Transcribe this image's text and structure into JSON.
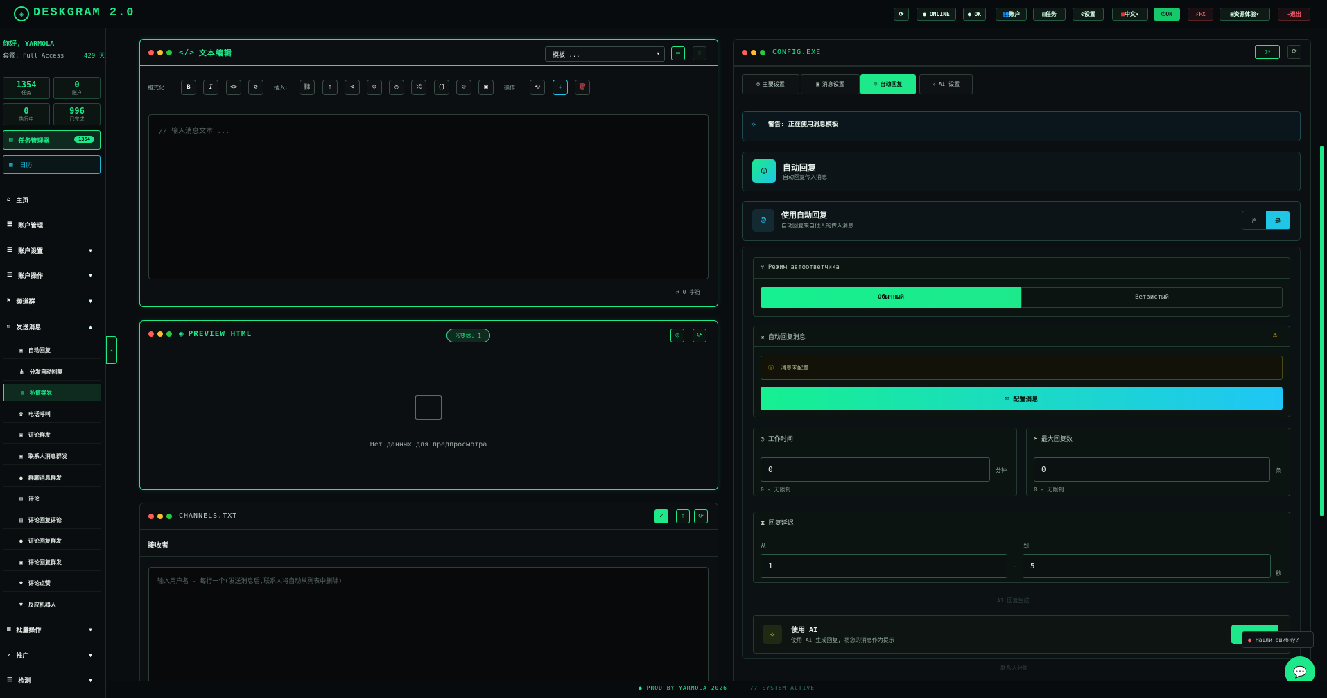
{
  "app": {
    "logo_glyph": "◈",
    "title": "DESKGRAM 2.0"
  },
  "topbar": {
    "refresh_icon": "⟳",
    "online": "● ONLINE",
    "ok": "● OK",
    "accounts": "账户",
    "tasks": "任务",
    "settings": "设置",
    "language": "中文",
    "on": "ON",
    "fx": "FX",
    "extra": "资源体验",
    "logout": "退出"
  },
  "user": {
    "greeting": "你好, YARMOLA",
    "access": "套餐: Full Access",
    "days": "429 天"
  },
  "stats": [
    {
      "value": "1354",
      "label": "任务"
    },
    {
      "value": "0",
      "label": "账户"
    },
    {
      "value": "0",
      "label": "执行中"
    },
    {
      "value": "996",
      "label": "已完成"
    }
  ],
  "task_manager": {
    "label": "任务管理器",
    "badge": "1354"
  },
  "calendar": {
    "label": "日历"
  },
  "nav": [
    {
      "label": "主页",
      "icon": "⌂"
    },
    {
      "label": "账户管理",
      "icon": "☰"
    },
    {
      "label": "账户设置",
      "icon": "☰"
    },
    {
      "label": "账户操作",
      "icon": "☰"
    },
    {
      "label": "频道群",
      "icon": "⚑"
    },
    {
      "label": "发送消息",
      "icon": "✉"
    }
  ],
  "subnav": [
    {
      "label": "自动回复",
      "icon": "▣"
    },
    {
      "label": "分发自动回复",
      "icon": "⋔"
    },
    {
      "label": "私信群发",
      "icon": "▤"
    },
    {
      "label": "电话呼叫",
      "icon": "☎"
    },
    {
      "label": "评论群发",
      "icon": "▣"
    },
    {
      "label": "联系人消息群发",
      "icon": "▣"
    },
    {
      "label": "群聊消息群发",
      "icon": "●"
    },
    {
      "label": "评论",
      "icon": "▤"
    },
    {
      "label": "评论回复评论",
      "icon": "▤"
    },
    {
      "label": "评论回复群发",
      "icon": "●"
    },
    {
      "label": "评论回复群发",
      "icon": "▣"
    },
    {
      "label": "评论点赞",
      "icon": "♥"
    },
    {
      "label": "反应机器人",
      "icon": "♥"
    }
  ],
  "nav_bottom": [
    {
      "label": "批量操作",
      "icon": "▦"
    },
    {
      "label": "推广",
      "icon": "↗"
    },
    {
      "label": "检测",
      "icon": "☰"
    }
  ],
  "editor": {
    "title": "文本编辑",
    "template_placeholder": "模板 ...",
    "format_label": "格式化:",
    "insert_label": "插入:",
    "actions_label": "操作:",
    "textarea_placeholder": "// 输入消息文本 ...",
    "char_count": "0 字符"
  },
  "preview": {
    "title": "PREVIEW HTML",
    "variants": "变体: 1",
    "empty": "Нет данных для предпросмотра"
  },
  "channels": {
    "title": "CHANNELS.TXT",
    "recipients": "接收者",
    "placeholder": "输入用户名 - 每行一个(发送消息后,联系人将自动从列表中删除)"
  },
  "config": {
    "title": "CONFIG.EXE",
    "tabs": [
      "主要设置",
      "消息设置",
      "自动回复",
      "AI 设置"
    ],
    "warning": "警告: 正在使用消息模板",
    "autoreply_title": "自动回复",
    "autoreply_sub": "自动回复传入消息",
    "use_title": "使用自动回复",
    "use_sub": "自动回复来自他人的传入消息",
    "toggle_off": "否",
    "toggle_on": "是",
    "mode_label": "Режим автоответчика",
    "mode_a": "Обычный",
    "mode_b": "Ветвистый",
    "msg_label": "自动回复消息",
    "msg_status": "消息未配置",
    "config_btn": "配置消息",
    "work_time": "工作时间",
    "work_value": "0",
    "work_unit": "分钟",
    "work_hint": "0 - 无限制",
    "max_replies": "最大回复数",
    "max_value": "0",
    "max_unit": "条",
    "max_hint": "0 - 无限制",
    "delay_label": "回复延迟",
    "from_label": "从",
    "to_label": "到",
    "from_value": "1",
    "to_value": "5",
    "sec_unit": "秒",
    "ai_note": "AI 回复生成",
    "ai_title": "使用 AI",
    "ai_sub": "使用 AI 生成回复, 将您的消息作为提示",
    "more_note": "联系人分组"
  },
  "chat_bubble": "Нашли ошибку?",
  "footer": {
    "prod": "● PROD BY YARMOLA 2026",
    "status": "// SYSTEM ACTIVE"
  },
  "colors": {
    "accent": "#1de98b",
    "cyan": "#1fc6e6",
    "danger": "#ff5c6c",
    "bg": "#0a0d10"
  }
}
